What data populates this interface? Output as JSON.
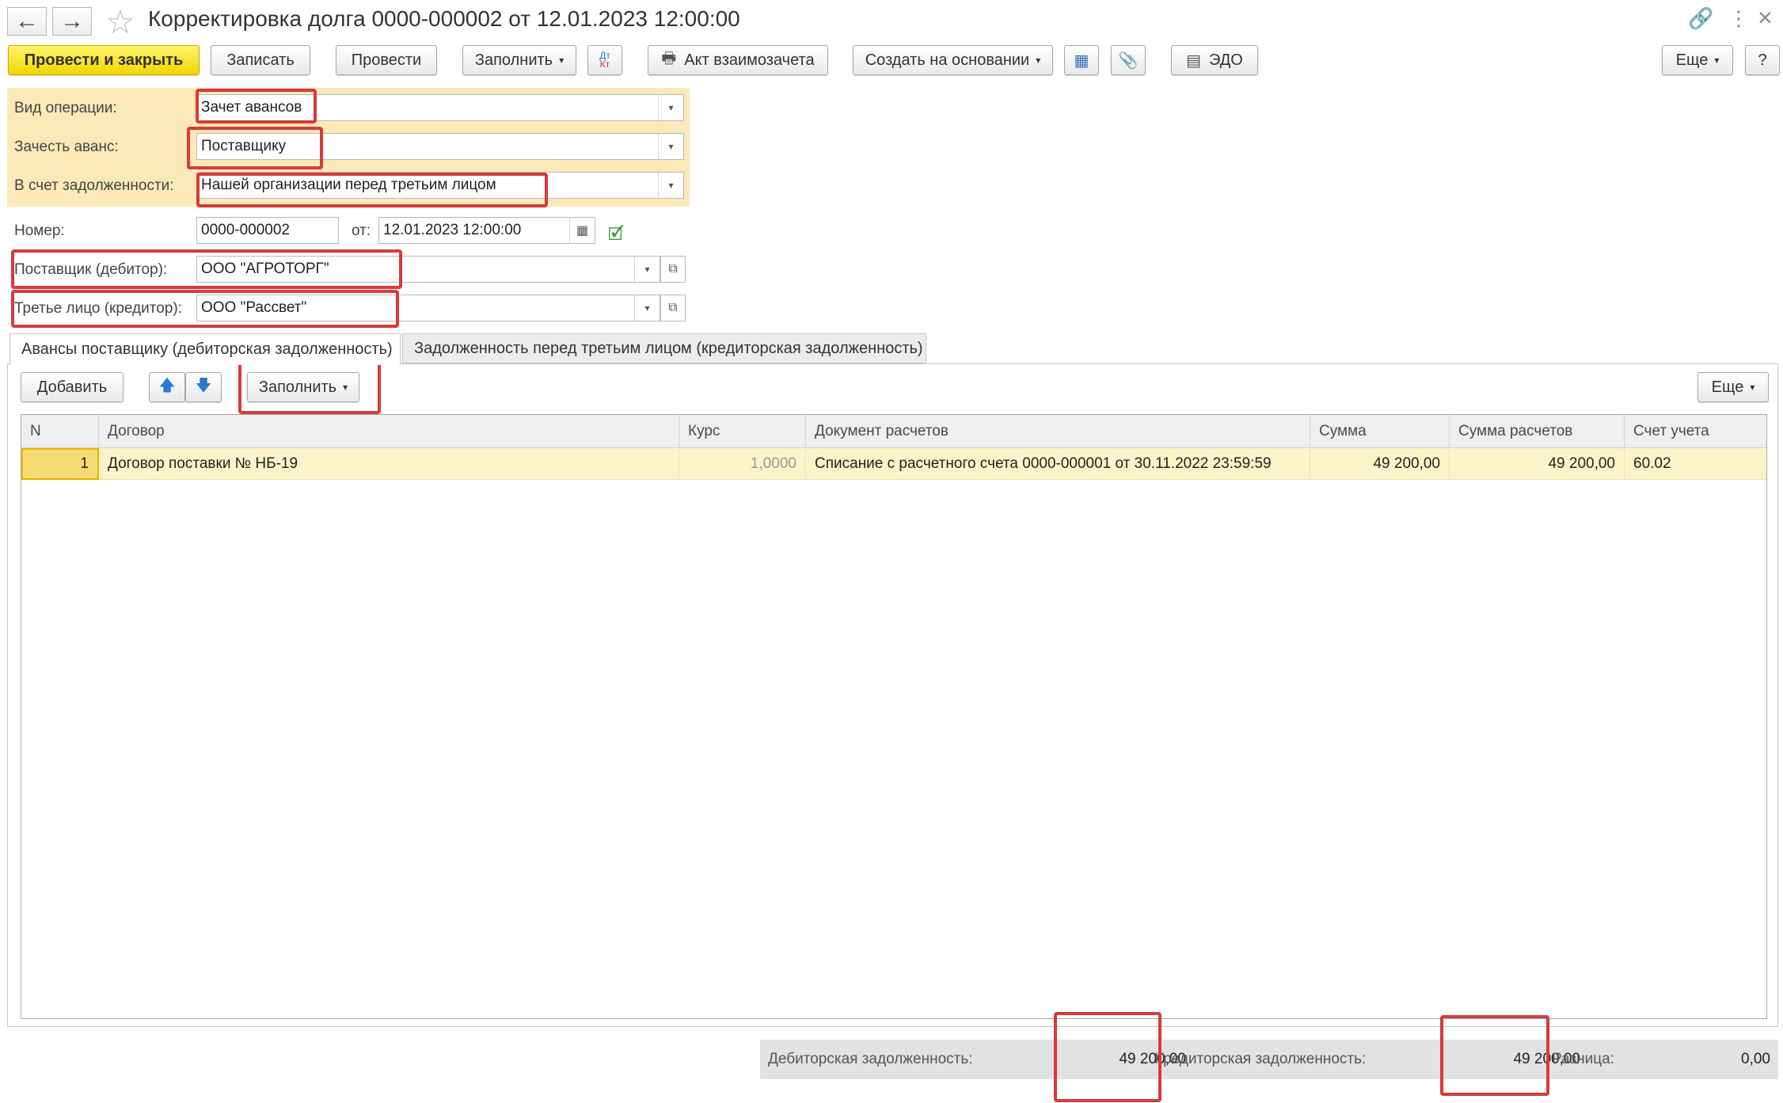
{
  "window": {
    "title": "Корректировка долга 0000-000002 от 12.01.2023 12:00:00",
    "back_icon": "←",
    "forward_icon": "→",
    "star_icon": "☆",
    "link_icon": "🔗",
    "more_icon": "⋮",
    "close_icon": "×"
  },
  "toolbar": {
    "post_close": "Провести и закрыть",
    "save": "Записать",
    "post": "Провести",
    "fill": "Заполнить",
    "dtkt_top": "Дт",
    "dtkt_bottom": "Кт",
    "act": "Акт взаимозачета",
    "create_based": "Создать на основании",
    "edo": "ЭДО",
    "more": "Еще",
    "help": "?"
  },
  "form": {
    "operation_label": "Вид операции:",
    "operation_value": "Зачет авансов",
    "offset_label": "Зачесть аванс:",
    "offset_value": "Поставщику",
    "debt_label": "В счет задолженности:",
    "debt_value": "Нашей организации перед третьим лицом",
    "number_label": "Номер:",
    "number_value": "0000-000002",
    "date_label": "от:",
    "date_value": "12.01.2023 12:00:00",
    "supplier_label": "Поставщик (дебитор):",
    "supplier_value": "ООО \"АГРОТОРГ\"",
    "third_party_label": "Третье лицо (кредитор):",
    "third_party_value": "ООО \"Рассвет\""
  },
  "tabs": [
    {
      "label": "Авансы поставщику (дебиторская задолженность)"
    },
    {
      "label": "Задолженность перед третьим лицом (кредиторская задолженность)"
    }
  ],
  "table_toolbar": {
    "add": "Добавить",
    "up_icon": "🡅",
    "down_icon": "🡇",
    "fill": "Заполнить",
    "more": "Еще"
  },
  "table": {
    "columns": [
      "N",
      "Договор",
      "Курс",
      "Документ расчетов",
      "Сумма",
      "Сумма расчетов",
      "Счет учета"
    ],
    "rows": [
      {
        "n": "1",
        "contract": "Договор поставки № НБ-19",
        "rate": "1,0000",
        "document": "Списание с расчетного счета 0000-000001 от 30.11.2022 23:59:59",
        "sum": "49 200,00",
        "settlement_sum": "49 200,00",
        "account": "60.02"
      }
    ]
  },
  "totals": {
    "debit_label": "Дебиторская задолженность:",
    "debit_value": "49 200,00",
    "credit_label": "Кредиторская задолженность:",
    "credit_value": "49 200,00",
    "diff_label": "Разница:",
    "diff_value": "0,00"
  },
  "colors": {
    "primary_button": "#f5e03a",
    "highlight_panel": "#fbe9b8",
    "selected_row": "#fcf3c8",
    "annotation": "#d83a3a"
  }
}
